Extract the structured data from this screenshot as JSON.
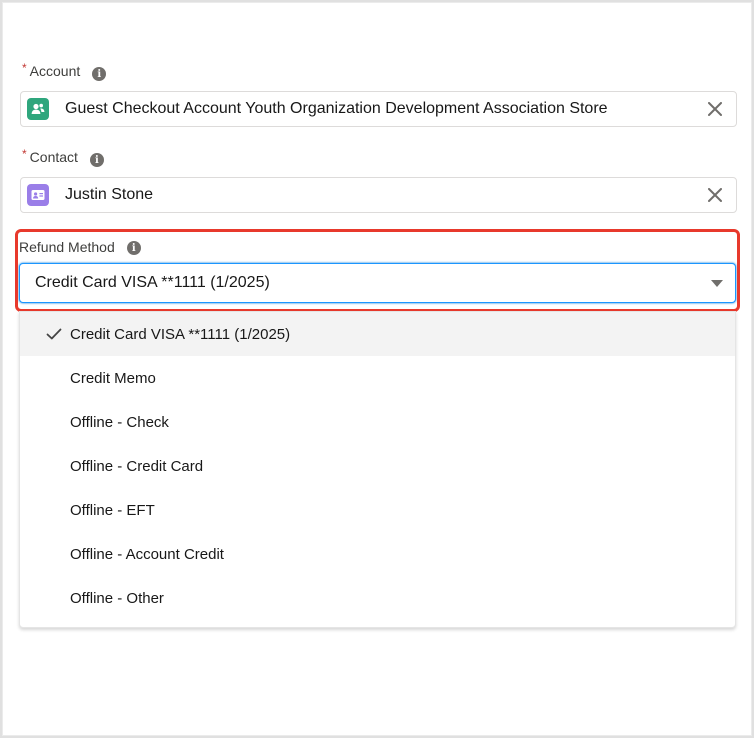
{
  "form": {
    "account": {
      "label": "Account",
      "required_marker": "*",
      "value": "Guest Checkout Account Youth Organization Development Association Store",
      "icon": "account-icon",
      "icon_color": "#2fa67d",
      "clear_icon": "close-icon"
    },
    "contact": {
      "label": "Contact",
      "required_marker": "*",
      "value": "Justin Stone",
      "icon": "contact-icon",
      "icon_color": "#9a7ee8",
      "clear_icon": "close-icon"
    },
    "refund_method": {
      "label": "Refund Method",
      "value": "Credit Card VISA **1111 (1/2025)",
      "highlight_color": "#e8392c",
      "focus_color": "#1b96ff",
      "options": [
        {
          "label": "Credit Card VISA **1111 (1/2025)",
          "selected": true
        },
        {
          "label": "Credit Memo",
          "selected": false
        },
        {
          "label": "Offline - Check",
          "selected": false
        },
        {
          "label": "Offline - Credit Card",
          "selected": false
        },
        {
          "label": "Offline - EFT",
          "selected": false
        },
        {
          "label": "Offline - Account Credit",
          "selected": false
        },
        {
          "label": "Offline - Other",
          "selected": false
        }
      ]
    },
    "info_icon_glyph": "i"
  }
}
